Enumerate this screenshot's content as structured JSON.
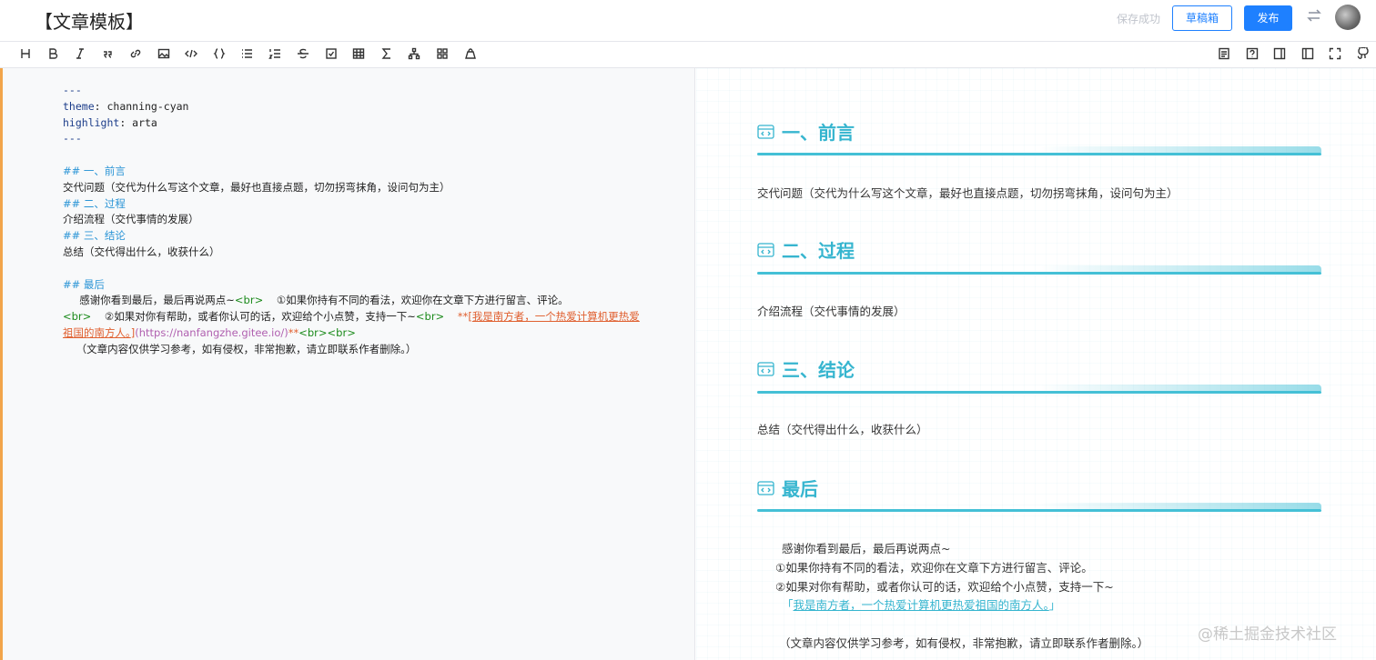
{
  "header": {
    "title": "【文章模板】",
    "save_status": "保存成功",
    "draft_button": "草稿箱",
    "publish_button": "发布",
    "switch_icon": "swap-icon",
    "avatar_icon": "user-avatar"
  },
  "toolbar": {
    "left_icons": [
      "heading-icon",
      "bold-icon",
      "italic-icon",
      "quote-icon",
      "link-icon",
      "image-icon",
      "code-icon",
      "code-block-icon",
      "unordered-list-icon",
      "ordered-list-icon",
      "strikethrough-icon",
      "task-list-icon",
      "table-icon",
      "formula-icon",
      "diagram-icon",
      "plugin-icon",
      "theme-icon"
    ],
    "right_icons": [
      "toc-icon",
      "help-icon",
      "preview-only-icon",
      "split-view-icon",
      "fullscreen-icon",
      "github-icon"
    ]
  },
  "editor": {
    "fm_start": "---",
    "theme_key": "theme",
    "theme_value": ": channing-cyan",
    "highlight_key": "highlight",
    "highlight_value": ": arta",
    "fm_end": "---",
    "h1": "## 一、前言",
    "p1": "交代问题（交代为什么写这个文章，最好也直接点题，切勿拐弯抹角，设问句为主）",
    "h2": "## 二、过程",
    "p2": "介绍流程（交代事情的发展）",
    "h3": "## 三、结论",
    "p3": "总结（交代得出什么，收获什么）",
    "h4": "## 最后",
    "last_a": "     感谢你看到最后，最后再说两点~",
    "last_br1": "<br>",
    "last_b": "    ①如果你持有不同的看法，欢迎你在文章下方进行留言、评论。",
    "last_br2": "<br>",
    "last_c": "    ②如果对你有帮助，或者你认可的话，欢迎给个小点赞，支持一下~",
    "last_br3": "<br>",
    "last_bold_open": "    **[",
    "last_link_text": "我是南方者，一个热爱计算机更热爱祖国的南方人。",
    "last_link_close": "]",
    "last_url": "(https://nanfangzhe.gitee.io/)",
    "last_bold_close": "**",
    "last_br4": "<br><br>",
    "last_d": "    （文章内容仅供学习参考，如有侵权，非常抱歉，请立即联系作者删除。）"
  },
  "preview": {
    "h1": "一、前言",
    "p1": "交代问题（交代为什么写这个文章，最好也直接点题，切勿拐弯抹角，设问句为主）",
    "h2": "二、过程",
    "p2": "介绍流程（交代事情的发展）",
    "h3": "三、结论",
    "p3": "总结（交代得出什么，收获什么）",
    "h4": "最后",
    "last_1": "感谢你看到最后，最后再说两点~",
    "last_2": "①如果你持有不同的看法，欢迎你在文章下方进行留言、评论。",
    "last_3": "②如果对你有帮助，或者你认可的话，欢迎给个小点赞，支持一下~",
    "link_open": "「",
    "link_text": "我是南方者，一个热爱计算机更热爱祖国的南方人。",
    "link_close": "」",
    "last_4": "（文章内容仅供学习参考，如有侵权，非常抱歉，请立即联系作者删除。）",
    "section_icon": "code-window-icon"
  },
  "watermark": "@稀土掘金技术社区",
  "colors": {
    "accent": "#1e80ff",
    "heading_cyan": "#36b5cf",
    "left_border": "#f2a54a"
  }
}
